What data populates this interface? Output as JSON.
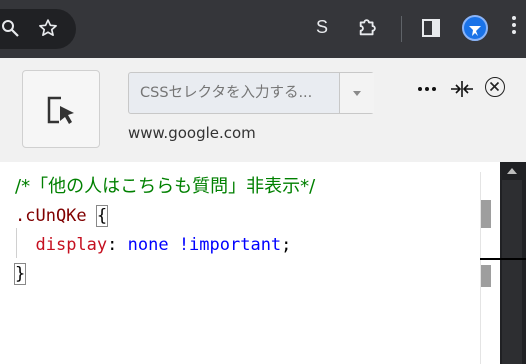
{
  "browser_toolbar": {
    "zoom_icon": "zoom-icon",
    "bookmark_icon": "star-icon",
    "extension_s_label": "S",
    "extensions_icon": "puzzle-icon",
    "side_panel_icon": "side-panel-icon",
    "profile_icon": "profile-avatar",
    "menu_icon": "vertical-dots-icon",
    "colors": {
      "background": "#35363a",
      "icon": "#e8eaed",
      "profile": "#1a73e8"
    }
  },
  "popup": {
    "picker_icon": "element-picker-icon",
    "selector_placeholder": "CSSセレクタを入力する...",
    "selector_value": "",
    "domain": "www.google.com",
    "more_icon": "more-horizontal-icon",
    "resize_icon": "resize-horizontal-icon",
    "close_icon": "close-circle-icon"
  },
  "editor": {
    "lines": [
      {
        "comment": "/*「他の人はこちらも質問」非表示*/"
      },
      {
        "selector": ".cUnQKe",
        "brace": "{"
      },
      {
        "property": "display",
        "colon": ":",
        "value": "none !important",
        "semicolon": ";"
      },
      {
        "brace": "}"
      }
    ],
    "colors": {
      "comment": "#008000",
      "selector": "#800000",
      "property": "#c50f1f",
      "value": "#0000ff"
    }
  }
}
